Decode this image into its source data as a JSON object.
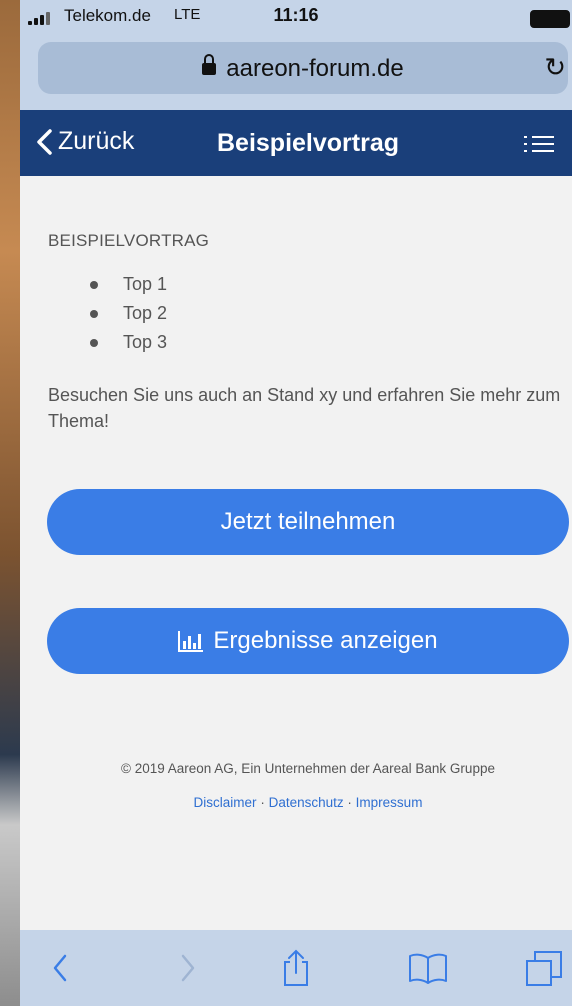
{
  "status_bar": {
    "carrier": "Telekom.de",
    "network": "LTE",
    "time": "11:16"
  },
  "browser": {
    "url": "aareon-forum.de"
  },
  "nav": {
    "back_label": "Zurück",
    "title": "Beispielvortrag"
  },
  "content": {
    "heading": "BEISPIELVORTRAG",
    "topics": [
      "Top 1",
      "Top 2",
      "Top 3"
    ],
    "paragraph": "Besuchen Sie uns auch an Stand xy und erfahren Sie mehr zum Thema!"
  },
  "buttons": {
    "join_label": "Jetzt teilnehmen",
    "results_label": "Ergebnisse anzeigen"
  },
  "footer": {
    "copyright": "© 2019 Aareon AG, Ein Unternehmen der Aareal Bank Gruppe",
    "disclaimer": "Disclaimer",
    "privacy": "Datenschutz",
    "imprint": "Impressum",
    "separator": "·"
  },
  "colors": {
    "nav_background": "#1a3f7a",
    "button_blue": "#3a7de6",
    "link_blue": "#2f6fd1",
    "safari_chrome": "#c5d4e8"
  },
  "icons": [
    "signal-icon",
    "battery-icon",
    "lock-icon",
    "reload-icon",
    "chevron-left-icon",
    "menu-icon",
    "bar-chart-icon",
    "back-arrow-icon",
    "forward-arrow-icon",
    "share-icon",
    "bookmarks-icon",
    "tabs-icon"
  ]
}
